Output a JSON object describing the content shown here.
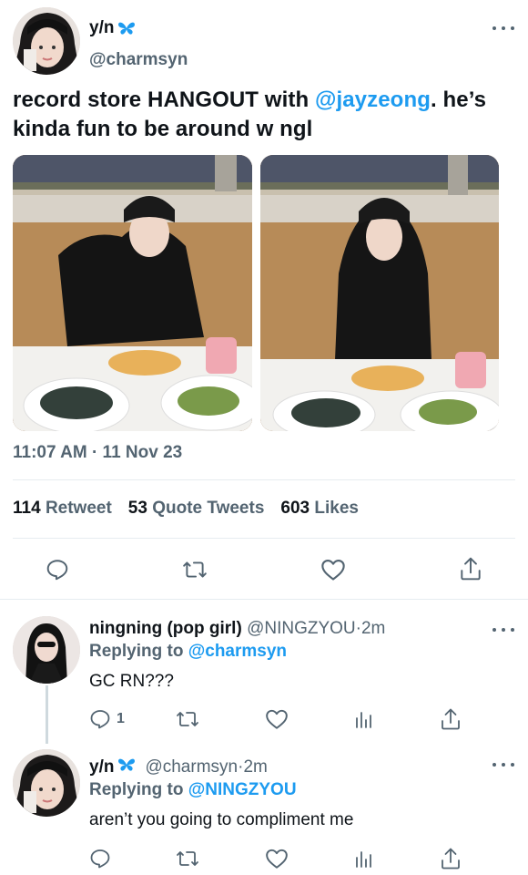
{
  "tweet": {
    "author_name": "y/n",
    "author_handle": "@charmsyn",
    "text_before": "record store HANGOUT with ",
    "mention": "@jayzeong",
    "text_after": ". he’s kinda fun to be around w ngl",
    "timestamp": "11:07 AM · 11 Nov 23",
    "stats": {
      "retweets": "114",
      "retweets_label": "Retweet",
      "quotes": "53",
      "quotes_label": "Quote Tweets",
      "likes": "603",
      "likes_label": "Likes"
    },
    "verified_icon": "butterfly-icon",
    "accent_color": "#1d9bf0"
  },
  "replies": [
    {
      "author_name": "ningning (pop girl)",
      "author_handle": "@NINGZYOU",
      "time": "2m",
      "replying_prefix": "Replying to ",
      "replying_to": "@charmsyn",
      "text": "GC RN???",
      "reply_count": "1"
    },
    {
      "author_name": "y/n",
      "author_handle": "@charmsyn",
      "time": "2m",
      "replying_prefix": "Replying to ",
      "replying_to": "@NINGZYOU",
      "text": "aren’t you going to compliment me",
      "reply_count": ""
    }
  ],
  "separator": " · "
}
